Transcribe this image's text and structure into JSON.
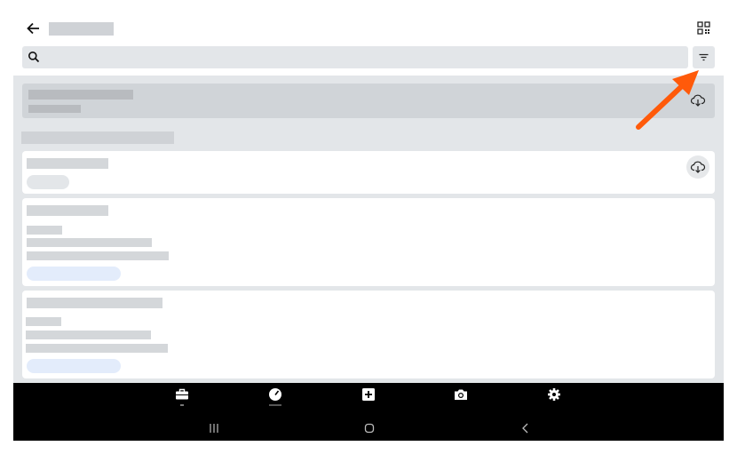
{
  "icons": {
    "back": "arrow-left-icon",
    "qr": "qr-code-icon",
    "search": "search-icon",
    "filter": "filter-icon",
    "cloud_download": "cloud-download-icon",
    "nav": [
      "briefcase-icon",
      "speedometer-icon",
      "plus-square-icon",
      "camera-icon",
      "gear-icon"
    ],
    "system": [
      "recent-apps-icon",
      "home-icon",
      "system-back-icon"
    ]
  },
  "colors": {
    "annotation_arrow": "#ff5a0a",
    "page_background": "#e3e6e9",
    "bottom_bar": "#000000",
    "chip_blue": "#e3ecfb",
    "chip_gray": "#e3e6e9"
  }
}
